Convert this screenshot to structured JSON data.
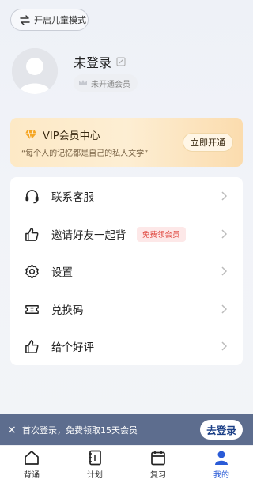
{
  "header": {
    "kids_mode_label": "开启儿童模式"
  },
  "profile": {
    "username": "未登录",
    "member_status": "未开通会员"
  },
  "vip": {
    "title": "VIP会员中心",
    "subtitle": "“每个人的记忆都是自己的私人文学”",
    "button": "立即开通"
  },
  "menu": {
    "items": [
      {
        "label": "联系客服",
        "icon": "headset-icon"
      },
      {
        "label": "邀请好友一起背",
        "icon": "thumbs-up-icon",
        "tag": "免费领会员"
      },
      {
        "label": "设置",
        "icon": "gear-icon"
      },
      {
        "label": "兑换码",
        "icon": "ticket-icon"
      },
      {
        "label": "给个好评",
        "icon": "thumbs-up-icon"
      }
    ]
  },
  "banner": {
    "close": "×",
    "text": "首次登录，免费领取15天会员",
    "button": "去登录"
  },
  "tabs": [
    {
      "label": "背诵",
      "icon": "house-icon"
    },
    {
      "label": "计划",
      "icon": "notebook-icon"
    },
    {
      "label": "复习",
      "icon": "calendar-icon"
    },
    {
      "label": "我的",
      "icon": "person-icon",
      "active": true
    }
  ],
  "colors": {
    "accent": "#2a5bd7",
    "banner": "#5d6d8e",
    "tag_red": "#e0483f",
    "vip_gold": "#fbdcae"
  }
}
